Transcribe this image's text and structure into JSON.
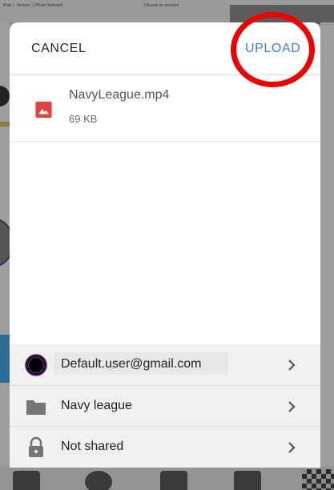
{
  "background": {
    "statusbar_left": "iPad ✓ Verizon",
    "statusbar_center": "1 Photo Selected",
    "statusbar_right": "Choose an account"
  },
  "sheet": {
    "cancel_label": "CANCEL",
    "upload_label": "UPLOAD",
    "file": {
      "name": "NavyLeague.mp4",
      "size": "69 KB",
      "icon": "image-file-icon"
    },
    "options": [
      {
        "label": "Default.user@gmail.com",
        "icon": "account-avatar-icon"
      },
      {
        "label": "Navy league",
        "icon": "folder-icon"
      },
      {
        "label": "Not shared",
        "icon": "lock-icon"
      }
    ]
  },
  "colors": {
    "accent": "#3d7fe0",
    "file_icon": "#e5433f",
    "highlight_circle": "#ee0000"
  }
}
